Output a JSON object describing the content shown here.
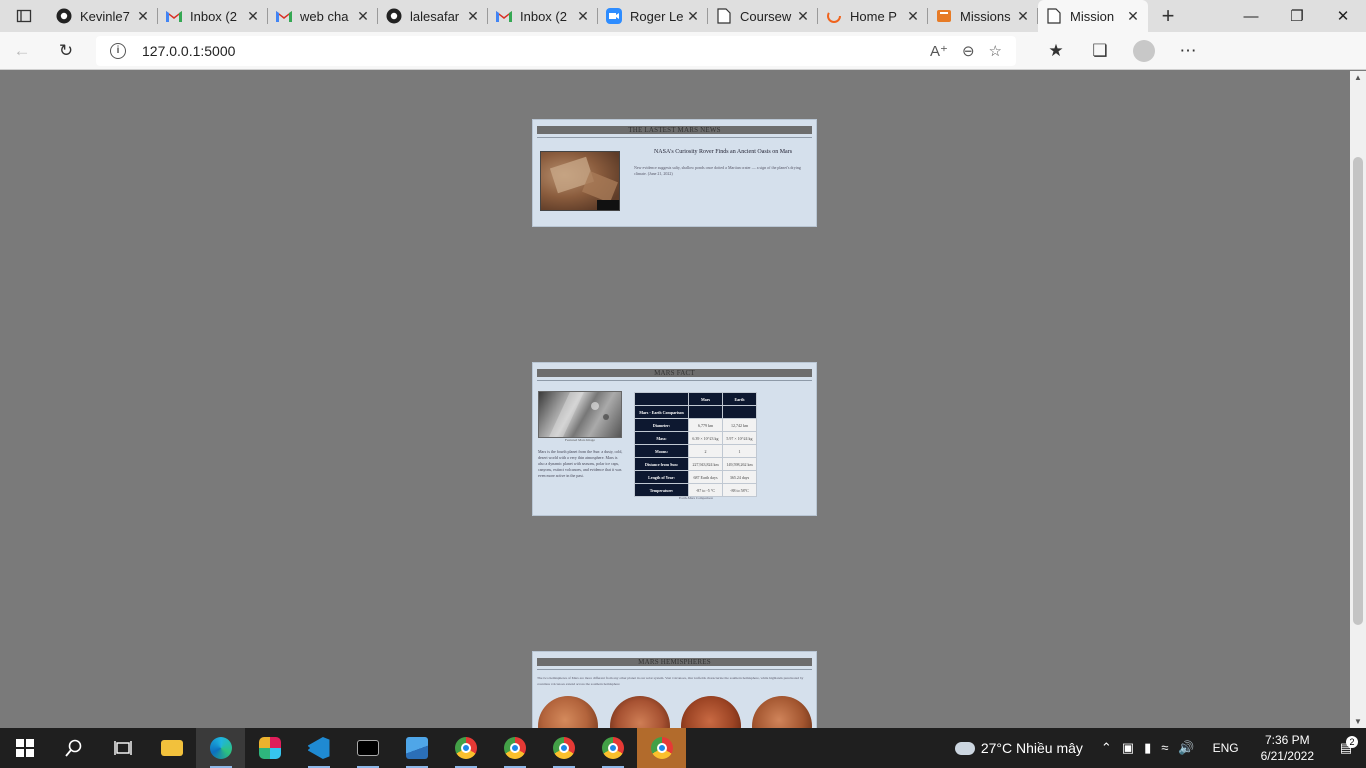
{
  "browser": {
    "tabs": [
      {
        "title": "Kevinle7",
        "icon": "github-icon"
      },
      {
        "title": "Inbox (2",
        "icon": "gmail-icon"
      },
      {
        "title": "web cha",
        "icon": "gmail-icon"
      },
      {
        "title": "lalesafar",
        "icon": "github-icon"
      },
      {
        "title": "Inbox (2",
        "icon": "gmail-icon"
      },
      {
        "title": "Roger Le",
        "icon": "zoom-icon"
      },
      {
        "title": "Coursew",
        "icon": "page-icon"
      },
      {
        "title": "Home P",
        "icon": "loading-icon"
      },
      {
        "title": "Missions",
        "icon": "book-icon"
      },
      {
        "title": "Mission",
        "icon": "page-icon",
        "active": true
      }
    ],
    "url": "127.0.0.1:5000"
  },
  "page": {
    "news": {
      "header": "THE LASTEST MARS NEWS",
      "title": "NASA's Curiosity Rover Finds an Ancient Oasis on Mars",
      "body": "New evidence suggests salty, shallow ponds once dotted a Martian crater — a sign of the planet's drying climate. (June 21, 2022)"
    },
    "facts": {
      "header": "MARS FACT",
      "image_caption": "Featured Mars Image",
      "text": "Mars is the fourth planet from the Sun: a dusty, cold, desert world with a very thin atmosphere. Mars is also a dynamic planet with seasons, polar ice caps, canyons, extinct volcanoes, and evidence that it was even more active in the past.",
      "table": {
        "columns": [
          "",
          "Mars",
          "Earth"
        ],
        "rows": [
          {
            "label": "Mars - Earth Comparison",
            "mars": "",
            "earth": ""
          },
          {
            "label": "Diameter:",
            "mars": "6,779 km",
            "earth": "12,742 km"
          },
          {
            "label": "Mass:",
            "mars": "6.39 × 10^23 kg",
            "earth": "5.97 × 10^24 kg"
          },
          {
            "label": "Moons:",
            "mars": "2",
            "earth": "1"
          },
          {
            "label": "Distance from Sun:",
            "mars": "227,943,824 km",
            "earth": "149,598,262 km"
          },
          {
            "label": "Length of Year:",
            "mars": "687 Earth days",
            "earth": "365.24 days"
          },
          {
            "label": "Temperature:",
            "mars": "-87 to -5 °C",
            "earth": "-88 to 58°C"
          }
        ]
      },
      "table_caption": "Earth-Mars Comparison"
    },
    "hemispheres": {
      "header": "MARS HEMISPHERES",
      "text": "The two hemispheres of Mars are more different from any other planet in our solar system. Vast volcanoes, Our icefields characterize the southern hemisphere, while highlands punctuated by countless volcanoes extend across the southern hemisphere"
    }
  },
  "taskbar": {
    "weather": "27°C  Nhiều mây",
    "lang": "ENG",
    "time": "7:36 PM",
    "date": "6/21/2022",
    "notifications": "2"
  }
}
